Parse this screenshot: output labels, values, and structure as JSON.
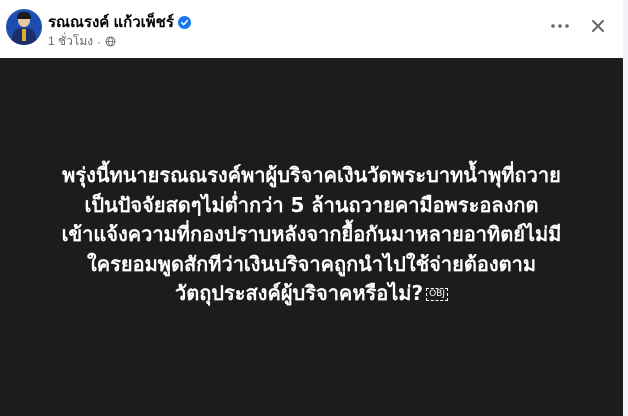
{
  "author": {
    "name": "รณณรงค์ แก้วเพ็ชร์",
    "verified": true,
    "timestamp": "1 ชั่วโมง",
    "dot": "·",
    "audience_icon": "globe-icon"
  },
  "actions": {
    "more_icon": "more-horizontal-icon",
    "close_icon": "close-icon"
  },
  "post": {
    "background_color": "#1c1c1c",
    "text_color": "#ffffff",
    "lines": [
      "พรุ่งนี้ทนายรณณรงค์พาผู้บริจาคเงินวัดพระบาทน้ำพุที่ถวาย",
      "เป็นปัจจัยสดๆไม่ต่ำกว่า 5 ล้านถวายคามือพระอลงกต",
      "เข้าแจ้งความที่กองปราบหลังจากยื้อกันมาหลายอาทิตย์ไม่มี",
      "ใครยอมพูดสักทีว่าเงินบริจาคถูกนำไปใช้จ่ายต้องตาม",
      "วัตถุประสงค์ผู้บริจาคหรือไม่?"
    ],
    "placeholder_glyph": "OBJ"
  }
}
